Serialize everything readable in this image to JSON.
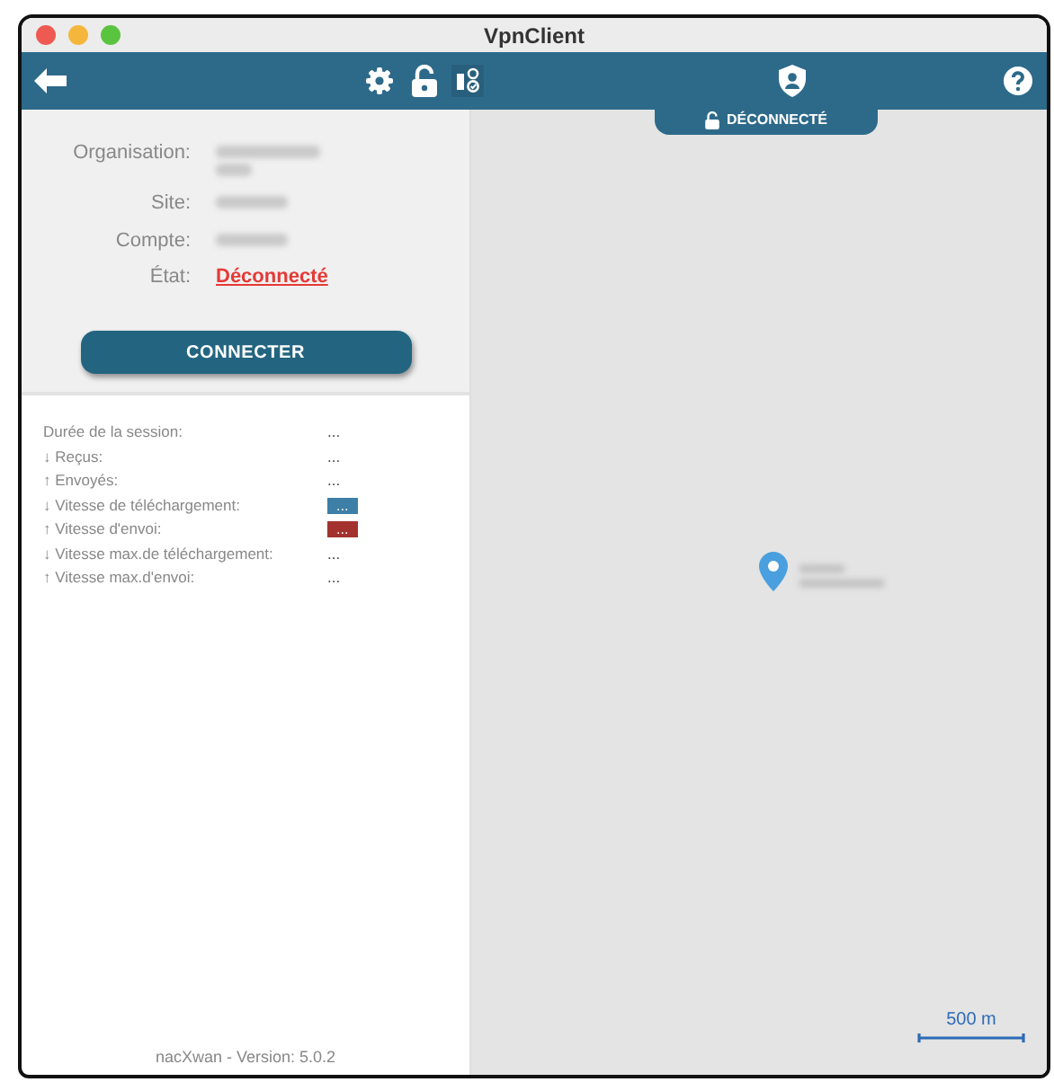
{
  "window": {
    "title": "VpnClient"
  },
  "status_tab": {
    "label": "DÉCONNECTÉ"
  },
  "details": [
    {
      "label": "Organisation:",
      "kind": "redacted_long"
    },
    {
      "label": "Site:",
      "kind": "redacted"
    },
    {
      "label": "Compte:",
      "kind": "redacted"
    },
    {
      "label": "État:",
      "kind": "status",
      "value": "Déconnecté"
    }
  ],
  "connect_button": {
    "label": "CONNECTER"
  },
  "stats": [
    {
      "label": "Durée de la session:",
      "value": "..."
    },
    {
      "label": "↓ Reçus:",
      "value": "..."
    },
    {
      "label": "↑ Envoyés:",
      "value": "..."
    },
    {
      "label": "↓ Vitesse de téléchargement:",
      "value": "...",
      "color": "#3d7fa6"
    },
    {
      "label": "↑ Vitesse d'envoi:",
      "value": "...",
      "color": "#a3322e"
    },
    {
      "label": "↓ Vitesse max.de téléchargement:",
      "value": "..."
    },
    {
      "label": "↑ Vitesse max.d'envoi:",
      "value": "..."
    }
  ],
  "footer": "nacXwan - Version: 5.0.2",
  "map": {
    "scale": "500 m"
  }
}
